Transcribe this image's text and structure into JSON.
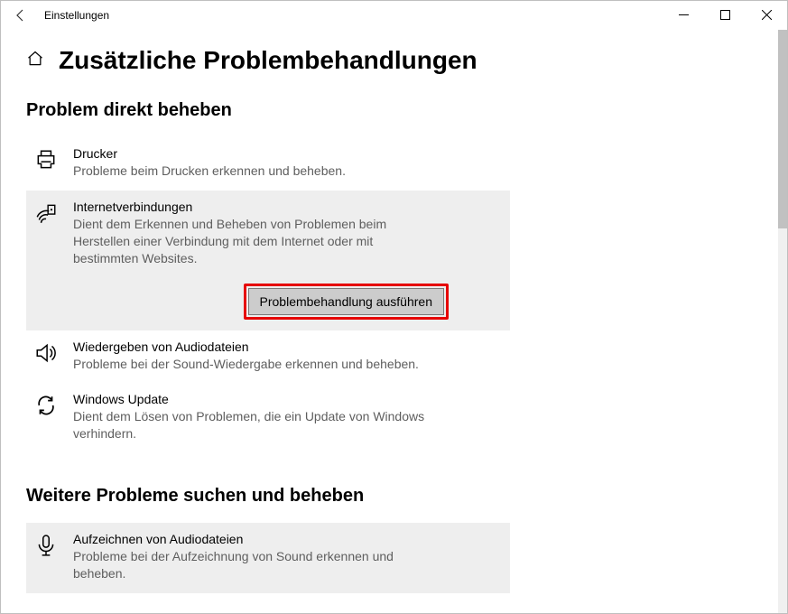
{
  "titlebar": {
    "app_title": "Einstellungen"
  },
  "page": {
    "title": "Zusätzliche Problembehandlungen"
  },
  "sections": {
    "fix_direct": {
      "title": "Problem direkt beheben",
      "items": {
        "printer": {
          "title": "Drucker",
          "desc": "Probleme beim Drucken erkennen und beheben."
        },
        "internet": {
          "title": "Internetverbindungen",
          "desc": "Dient dem Erkennen und Beheben von Problemen beim Herstellen einer Verbindung mit dem Internet oder mit bestimmten Websites.",
          "run_label": "Problembehandlung ausführen"
        },
        "audio_play": {
          "title": "Wiedergeben von Audiodateien",
          "desc": "Probleme bei der Sound-Wiedergabe erkennen und beheben."
        },
        "windows_update": {
          "title": "Windows Update",
          "desc": "Dient dem Lösen von Problemen, die ein Update von Windows verhindern."
        }
      }
    },
    "find_more": {
      "title": "Weitere Probleme suchen und beheben",
      "items": {
        "audio_record": {
          "title": "Aufzeichnen von Audiodateien",
          "desc": "Probleme bei der Aufzeichnung von Sound erkennen und beheben."
        }
      }
    }
  }
}
